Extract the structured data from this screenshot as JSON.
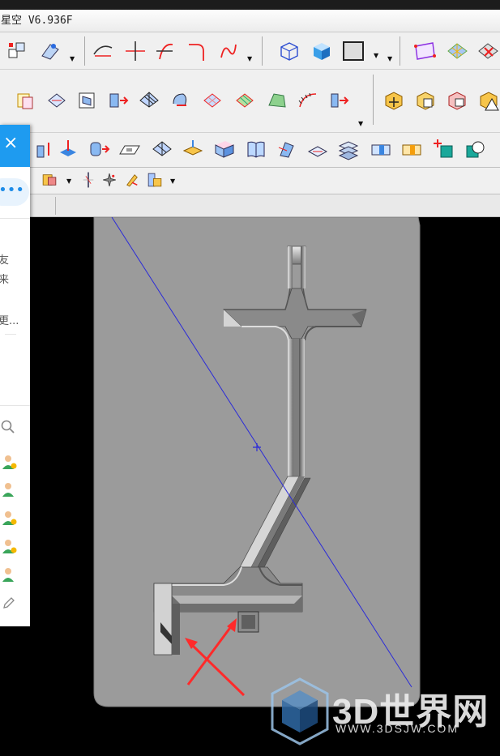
{
  "window": {
    "title": "星空 V6.936F"
  },
  "toolbars": {
    "row1": [
      "curve-offset-icon",
      "line-cross-icon",
      "curve-trim-icon",
      "fillet-curve-icon",
      "curve-arrow-icon",
      "wireframe-box-icon",
      "shaded-box-icon",
      "display-rect-icon",
      "surface-quad-icon",
      "surface-mesh-icon",
      "surface-delete-icon"
    ],
    "row2": [
      "surface-from-box-icon",
      "surface-rotate-icon",
      "surface-edit-icon",
      "surface-extrude-icon",
      "surface-grid-icon",
      "surface-sweep-icon",
      "surface-patch-icon",
      "surface-stripe-icon",
      "surface-fan-icon",
      "surface-thicken-icon",
      "solid-move-icon",
      "solid-cut-icon",
      "solid-copy-icon",
      "solid-warning-icon"
    ],
    "row3": [
      "extrude-arrow-icon",
      "cylinder-arrow-icon",
      "plate-icon",
      "surface-flat-icon",
      "slab-icon",
      "box-cut-icon",
      "book-icon",
      "twist-icon",
      "plate-flat-icon",
      "layer-stack-icon",
      "block-icon",
      "block-highlight-icon",
      "boolean-add-icon",
      "boolean-subtract-icon"
    ],
    "row4": [
      "small-cube-icon",
      "axis-icon",
      "sparkle-icon",
      "pen-icon"
    ]
  },
  "sidepanel": {
    "close": "×",
    "more": "•••",
    "lines": [
      "友",
      "来",
      "更..."
    ],
    "avatar_count": 5
  },
  "watermark": {
    "brand": "3D世界网",
    "url": "WWW.3DSJW.COM"
  },
  "colors": {
    "accent": "#1e9bf0",
    "model": "#9b9b9b",
    "annotation": "#ff2a2a",
    "guide_line": "#2b2bd8"
  }
}
